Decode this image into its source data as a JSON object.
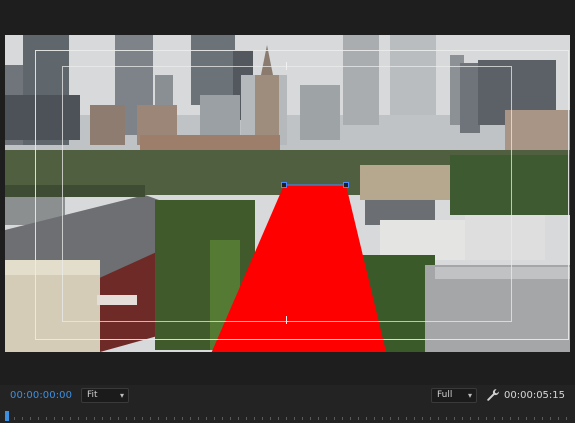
{
  "player": {
    "current_timecode": "00:00:00:00",
    "duration_timecode": "00:00:05:15",
    "zoom_level": "Fit",
    "playback_resolution": "Full"
  },
  "overlay": {
    "mask_color": "#ff0000",
    "safe_margins_color": "#ececec",
    "handle_color": "#4a8cff"
  },
  "icons": {
    "zoom_chevron": "chevron-down-icon",
    "resolution_chevron": "chevron-down-icon",
    "settings": "wrench-icon",
    "playhead": "playhead-icon"
  },
  "colors": {
    "panel_background": "#232323",
    "timecode_accent": "#3d8fe0"
  }
}
